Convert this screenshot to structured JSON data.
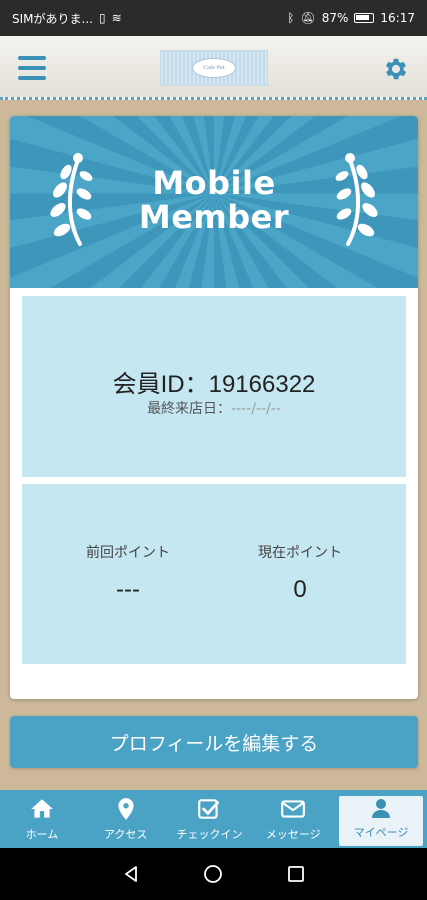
{
  "status_bar": {
    "carrier": "SIMがありま...",
    "battery_percent": "87%",
    "time": "16:17"
  },
  "header": {
    "logo_text": "Cafe Pot"
  },
  "card": {
    "banner_title_line1": "Mobile",
    "banner_title_line2": "Member",
    "member_id_label": "会員ID：",
    "member_id_value": "19166322",
    "last_visit_label": "最終来店日：",
    "last_visit_value": "----/--/--",
    "prev_points_label": "前回ポイント",
    "prev_points_value": "---",
    "current_points_label": "現在ポイント",
    "current_points_value": "0"
  },
  "profile_button_label": "プロフィールを編集する",
  "bottom_nav": [
    {
      "label": "ホーム",
      "icon": "home-icon"
    },
    {
      "label": "アクセス",
      "icon": "location-pin-icon"
    },
    {
      "label": "チェックイン",
      "icon": "checkin-icon"
    },
    {
      "label": "メッセージ",
      "icon": "mail-icon"
    },
    {
      "label": "マイページ",
      "icon": "person-icon",
      "active": true
    }
  ],
  "colors": {
    "accent": "#4aa3c4",
    "panel": "#c5e7f1",
    "background": "#cdb99a"
  }
}
